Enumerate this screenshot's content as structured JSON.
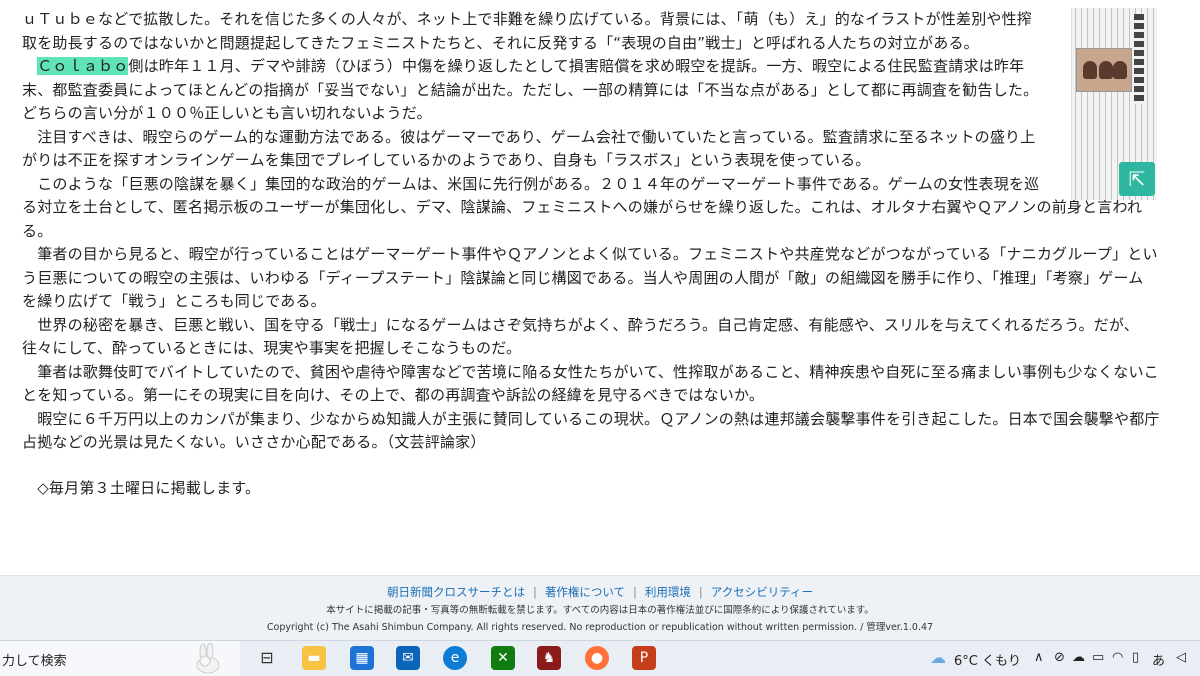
{
  "article": {
    "p1": [
      "ｕＴｕｂｅなどで拡散した。それを信じた多くの人々が、ネット上で非難を繰り広げている。背景には、「萌（も）え」的なイラストが性差別や性搾",
      "取を助長するのではないかと問題提起してきたフェミニストたちと、それに反発する「“表現の自由”戦士」と呼ばれる人たちの対立がある。"
    ],
    "p2_indent": "　",
    "p2_highlight": "Ｃｏｌａｂｏ",
    "p2_rest": "側は昨年１１月、デマや誹謗（ひぼう）中傷を繰り返したとして損害賠償を求め暇空を提訴。一方、暇空による住民監査請求は昨年",
    "p2": [
      "末、都監査委員によってほとんどの指摘が「妥当でない」と結論が出た。ただし、一部の精算には「不当な点がある」として都に再調査を勧告した。",
      "どちらの言い分が１００％正しいとも言い切れないようだ。"
    ],
    "p3": [
      "　注目すべきは、暇空らのゲーム的な運動方法である。彼はゲーマーであり、ゲーム会社で働いていたと言っている。監査請求に至るネットの盛り上",
      "がりは不正を探すオンラインゲームを集団でプレイしているかのようであり、自身も「ラスボス」という表現を使っている。"
    ],
    "p4": [
      "　このような「巨悪の陰謀を暴く」集団的な政治的ゲームは、米国に先行例がある。２０１４年のゲーマーゲート事件である。ゲームの女性表現を巡",
      "る対立を土台として、匿名掲示板のユーザーが集団化し、デマ、陰謀論、フェミニストへの嫌がらせを繰り返した。これは、オルタナ右翼やＱアノンの前身と言われ",
      "る。"
    ],
    "p5": [
      "　筆者の目から見ると、暇空が行っていることはゲーマーゲート事件やＱアノンとよく似ている。フェミニストや共産党などがつながっている「ナニカグループ」とい",
      "う巨悪についての暇空の主張は、いわゆる「ディープステート」陰謀論と同じ構図である。当人や周囲の人間が「敵」の組織図を勝手に作り、「推理」「考察」ゲーム",
      "を繰り広げて「戦う」ところも同じである。"
    ],
    "p6": [
      "　世界の秘密を暴き、巨悪と戦い、国を守る「戦士」になるゲームはさぞ気持ちがよく、酔うだろう。自己肯定感、有能感や、スリルを与えてくれるだろう。だが、",
      "往々にして、酔っているときには、現実や事実を把握しそこなうものだ。"
    ],
    "p7": [
      "　筆者は歌舞伎町でバイトしていたので、貧困や虐待や障害などで苦境に陥る女性たちがいて、性搾取があること、精神疾患や自死に至る痛ましい事例も少なくないこ",
      "とを知っている。第一にその現実に目を向け、その上で、都の再調査や訴訟の経緯を見守るべきではないか。"
    ],
    "p8": [
      "　暇空に６千万円以上のカンパが集まり、少なからぬ知識人が主張に賛同しているこの現状。Ｑアノンの熱は連邦議会襲撃事件を引き起こした。日本で国会襲撃や都庁",
      "占拠などの光景は見たくない。いささか心配である。（文芸評論家）"
    ],
    "schedule": "　◇毎月第３土曜日に掲載します。"
  },
  "footer": {
    "links": [
      "朝日新聞クロスサーチとは",
      "著作権について",
      "利用環境",
      "アクセシビリティー"
    ],
    "notice": "本サイトに掲載の記事・写真等の無断転載を禁じます。すべての内容は日本の著作権法並びに国際条約により保護されています。",
    "copyright": "Copyright (c) The Asahi Shimbun Company. All rights reserved. No reproduction or republication without written permission. / 管理ver.1.0.47"
  },
  "taskbar": {
    "search_text": "力して検索",
    "weather": "6°C  くもり",
    "colors": {
      "firefox": "#ff7139",
      "powerpoint": "#c43e1c",
      "xbox": "#107c10",
      "edge": "#0c7cd5",
      "mail": "#0a64b8",
      "store": "#1e74d6",
      "explorer": "#f6c342"
    }
  },
  "thumbnail": {
    "button_icon": "⇱"
  }
}
